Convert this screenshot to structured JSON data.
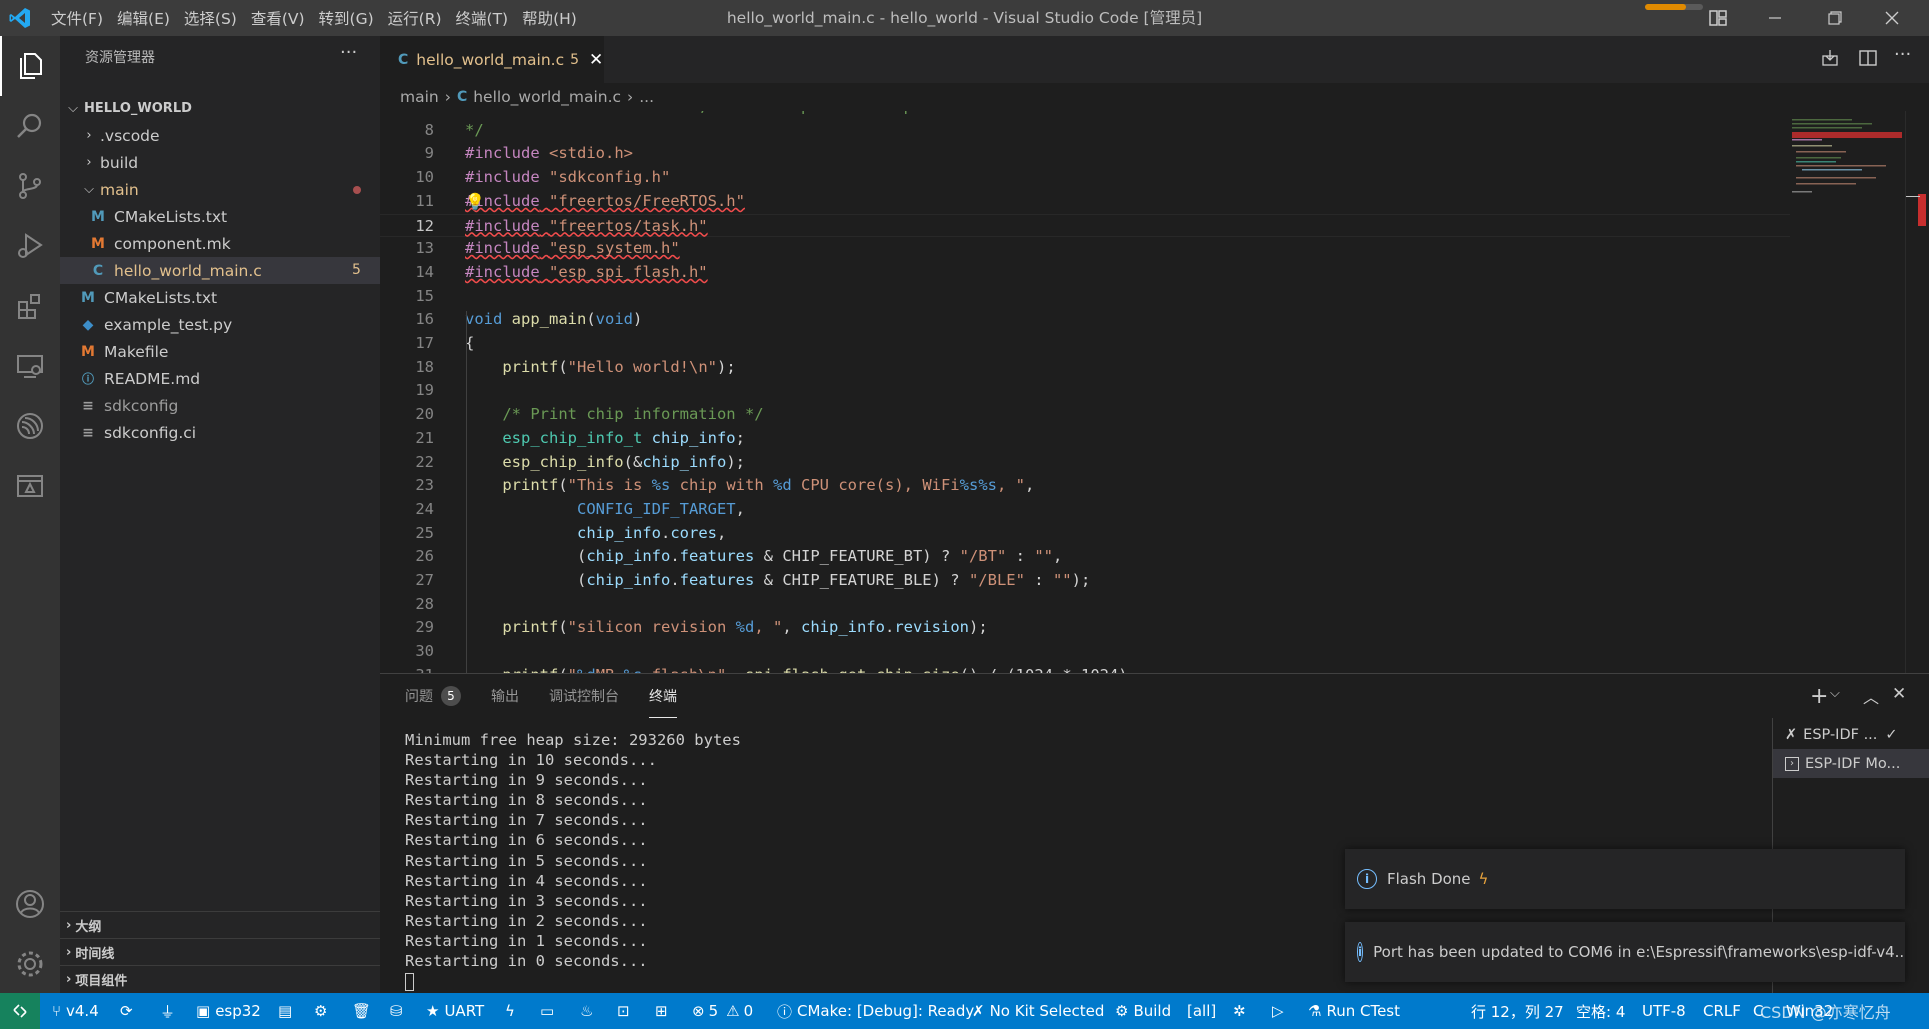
{
  "titlebar": {
    "menu": [
      "文件(F)",
      "编辑(E)",
      "选择(S)",
      "查看(V)",
      "转到(G)",
      "运行(R)",
      "终端(T)",
      "帮助(H)"
    ],
    "title": "hello_world_main.c - hello_world - Visual Studio Code [管理员]"
  },
  "sidebar": {
    "title": "资源管理器",
    "root": "HELLO_WORLD",
    "items": [
      {
        "label": ".vscode",
        "type": "folder",
        "icon": "chevron-right-icon"
      },
      {
        "label": "build",
        "type": "folder",
        "icon": "chevron-right-icon"
      },
      {
        "label": "main",
        "type": "folder-open",
        "icon": "chevron-down-icon"
      },
      {
        "label": "CMakeLists.txt",
        "type": "file",
        "icon": "M"
      },
      {
        "label": "component.mk",
        "type": "file",
        "icon": "M"
      },
      {
        "label": "hello_world_main.c",
        "type": "file",
        "icon": "C",
        "badge": "5"
      },
      {
        "label": "CMakeLists.txt",
        "type": "file",
        "icon": "M"
      },
      {
        "label": "example_test.py",
        "type": "file",
        "icon": "python-icon"
      },
      {
        "label": "Makefile",
        "type": "file",
        "icon": "M"
      },
      {
        "label": "README.md",
        "type": "file",
        "icon": "info-icon"
      },
      {
        "label": "sdkconfig",
        "type": "file",
        "icon": "lines-icon"
      },
      {
        "label": "sdkconfig.ci",
        "type": "file",
        "icon": "lines-icon"
      }
    ],
    "sections": [
      "大纲",
      "时间线",
      "项目组件"
    ]
  },
  "editor": {
    "tab": {
      "icon": "C",
      "label": "hello_world_main.c",
      "badge": "5"
    },
    "breadcrumb": [
      "main",
      "hello_world_main.c",
      "..."
    ],
    "cursor_line": 12
  },
  "panel": {
    "tabs": [
      "问题",
      "输出",
      "调试控制台",
      "终端"
    ],
    "problems_count": "5",
    "active_tab": "终端",
    "terminal_lines": [
      "Minimum free heap size: 293260 bytes",
      "Restarting in 10 seconds...",
      "Restarting in 9 seconds...",
      "Restarting in 8 seconds...",
      "Restarting in 7 seconds...",
      "Restarting in 6 seconds...",
      "Restarting in 5 seconds...",
      "Restarting in 4 seconds...",
      "Restarting in 3 seconds...",
      "Restarting in 2 seconds...",
      "Restarting in 1 seconds...",
      "Restarting in 0 seconds..."
    ],
    "terminals": [
      "ESP-IDF ...",
      "ESP-IDF Mo..."
    ]
  },
  "notifications": [
    {
      "text": "Flash Done"
    },
    {
      "text": "Port has been updated to COM6 in e:\\Espressif\\frameworks\\esp-idf-v4..."
    }
  ],
  "statusbar": {
    "branch": "v4.4",
    "target": "esp32",
    "uart": "UART",
    "problems": "5",
    "warnings": "0",
    "cmake": "CMake: [Debug]: Ready",
    "kit": "No Kit Selected",
    "build": "Build",
    "build_target": "[all]",
    "ctest": "Run CTest",
    "position": "行 12，列 27",
    "spaces": "空格: 4",
    "encoding": "UTF-8",
    "eol": "CRLF",
    "lang_short": "C",
    "platform": "Win32",
    "watermark": "CSDN @亦寒忆舟"
  },
  "colors": {
    "accent": "#007acc",
    "modified": "#e2c08d",
    "error": "#f14c4c"
  }
}
